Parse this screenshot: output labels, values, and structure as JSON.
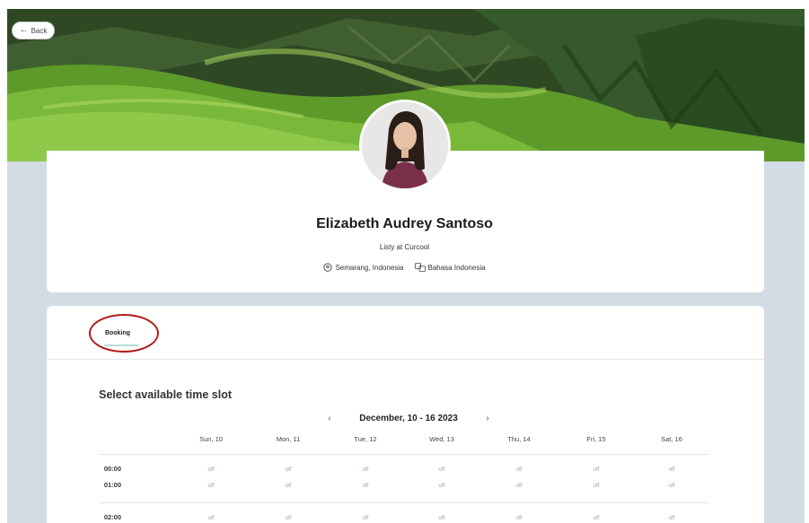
{
  "header": {
    "back_label": "Back"
  },
  "profile": {
    "name": "Elizabeth Audrey Santoso",
    "role": "Listy at Curcool",
    "location": "Semarang, Indonesia",
    "language": "Bahasa Indonesia"
  },
  "tabs": [
    {
      "label": "Booking",
      "active": true
    }
  ],
  "booking": {
    "title": "Select available time slot",
    "week_label": "December, 10 - 16 2023",
    "prev_icon": "‹",
    "next_icon": "›",
    "days": [
      "Sun, 10",
      "Mon, 11",
      "Tue, 12",
      "Wed, 13",
      "Thu, 14",
      "Fri, 15",
      "Sat, 16"
    ],
    "rows": [
      {
        "time": "00:00",
        "slots": [
          "off",
          "off",
          "off",
          "off",
          "off",
          "off",
          "off"
        ]
      },
      {
        "time": "01:00",
        "slots": [
          "off",
          "off",
          "off",
          "off",
          "off",
          "off",
          "off"
        ]
      },
      {
        "time": "02:00",
        "slots": [
          "off",
          "off",
          "off",
          "off",
          "off",
          "off",
          "off"
        ]
      }
    ]
  },
  "colors": {
    "accent_underline": "#b5dcd7",
    "highlight_ring": "#b01c1c",
    "page_bg": "#d3dbe4"
  }
}
